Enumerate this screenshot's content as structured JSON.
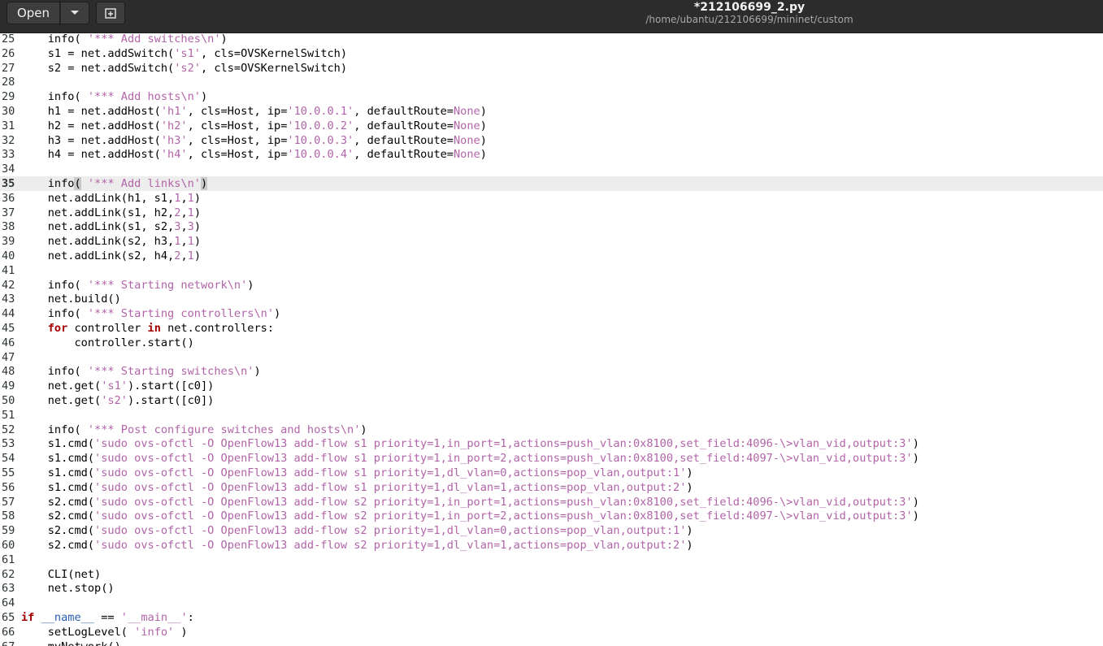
{
  "toolbar": {
    "open_label": "Open",
    "dropdown_icon": "chevron-down-icon",
    "new_tab_icon": "new-tab-icon"
  },
  "window": {
    "title": "*212106699_2.py",
    "subtitle": "/home/ubantu/212106699/mininet/custom"
  },
  "colors": {
    "string": "#b264a8",
    "keyword": "#a40000",
    "current_line": "#ededed",
    "headerbar": "#2c2c2c"
  },
  "editor": {
    "current_line": "35",
    "lines": [
      {
        "num": "25",
        "tokens": [
          [
            "",
            "    info( "
          ],
          [
            "s",
            "'*** Add switches\\n'"
          ],
          [
            "",
            ")"
          ]
        ]
      },
      {
        "num": "26",
        "tokens": [
          [
            "",
            "    s1 = net.addSwitch("
          ],
          [
            "s",
            "'s1'"
          ],
          [
            "",
            ", cls=OVSKernelSwitch)"
          ]
        ]
      },
      {
        "num": "27",
        "tokens": [
          [
            "",
            "    s2 = net.addSwitch("
          ],
          [
            "s",
            "'s2'"
          ],
          [
            "",
            ", cls=OVSKernelSwitch)"
          ]
        ]
      },
      {
        "num": "28",
        "tokens": []
      },
      {
        "num": "29",
        "tokens": [
          [
            "",
            "    info( "
          ],
          [
            "s",
            "'*** Add hosts\\n'"
          ],
          [
            "",
            ")"
          ]
        ]
      },
      {
        "num": "30",
        "tokens": [
          [
            "",
            "    h1 = net.addHost("
          ],
          [
            "s",
            "'h1'"
          ],
          [
            "",
            ", cls=Host, ip="
          ],
          [
            "s",
            "'10.0.0.1'"
          ],
          [
            "",
            ", defaultRoute="
          ],
          [
            "n",
            "None"
          ],
          [
            "",
            ")"
          ]
        ]
      },
      {
        "num": "31",
        "tokens": [
          [
            "",
            "    h2 = net.addHost("
          ],
          [
            "s",
            "'h2'"
          ],
          [
            "",
            ", cls=Host, ip="
          ],
          [
            "s",
            "'10.0.0.2'"
          ],
          [
            "",
            ", defaultRoute="
          ],
          [
            "n",
            "None"
          ],
          [
            "",
            ")"
          ]
        ]
      },
      {
        "num": "32",
        "tokens": [
          [
            "",
            "    h3 = net.addHost("
          ],
          [
            "s",
            "'h3'"
          ],
          [
            "",
            ", cls=Host, ip="
          ],
          [
            "s",
            "'10.0.0.3'"
          ],
          [
            "",
            ", defaultRoute="
          ],
          [
            "n",
            "None"
          ],
          [
            "",
            ")"
          ]
        ]
      },
      {
        "num": "33",
        "tokens": [
          [
            "",
            "    h4 = net.addHost("
          ],
          [
            "s",
            "'h4'"
          ],
          [
            "",
            ", cls=Host, ip="
          ],
          [
            "s",
            "'10.0.0.4'"
          ],
          [
            "",
            ", defaultRoute="
          ],
          [
            "n",
            "None"
          ],
          [
            "",
            ")"
          ]
        ]
      },
      {
        "num": "34",
        "tokens": []
      },
      {
        "num": "35",
        "tokens": [
          [
            "",
            "    info"
          ],
          [
            "bracket",
            "("
          ],
          [
            "",
            " "
          ],
          [
            "s",
            "'*** Add links\\n'"
          ],
          [
            "bracket",
            ")"
          ]
        ]
      },
      {
        "num": "36",
        "tokens": [
          [
            "",
            "    net.addLink(h1, s1,"
          ],
          [
            "s",
            "1"
          ],
          [
            "",
            ","
          ],
          [
            "s",
            "1"
          ],
          [
            "",
            ")"
          ]
        ]
      },
      {
        "num": "37",
        "tokens": [
          [
            "",
            "    net.addLink(s1, h2,"
          ],
          [
            "s",
            "2"
          ],
          [
            "",
            ","
          ],
          [
            "s",
            "1"
          ],
          [
            "",
            ")"
          ]
        ]
      },
      {
        "num": "38",
        "tokens": [
          [
            "",
            "    net.addLink(s1, s2,"
          ],
          [
            "s",
            "3"
          ],
          [
            "",
            ","
          ],
          [
            "s",
            "3"
          ],
          [
            "",
            ")"
          ]
        ]
      },
      {
        "num": "39",
        "tokens": [
          [
            "",
            "    net.addLink(s2, h3,"
          ],
          [
            "s",
            "1"
          ],
          [
            "",
            ","
          ],
          [
            "s",
            "1"
          ],
          [
            "",
            ")"
          ]
        ]
      },
      {
        "num": "40",
        "tokens": [
          [
            "",
            "    net.addLink(s2, h4,"
          ],
          [
            "s",
            "2"
          ],
          [
            "",
            ","
          ],
          [
            "s",
            "1"
          ],
          [
            "",
            ")"
          ]
        ]
      },
      {
        "num": "41",
        "tokens": []
      },
      {
        "num": "42",
        "tokens": [
          [
            "",
            "    info( "
          ],
          [
            "s",
            "'*** Starting network\\n'"
          ],
          [
            "",
            ")"
          ]
        ]
      },
      {
        "num": "43",
        "tokens": [
          [
            "",
            "    net.build()"
          ]
        ]
      },
      {
        "num": "44",
        "tokens": [
          [
            "",
            "    info( "
          ],
          [
            "s",
            "'*** Starting controllers\\n'"
          ],
          [
            "",
            ")"
          ]
        ]
      },
      {
        "num": "45",
        "tokens": [
          [
            "",
            "    "
          ],
          [
            "k",
            "for"
          ],
          [
            "",
            " controller "
          ],
          [
            "k",
            "in"
          ],
          [
            "",
            " net.controllers:"
          ]
        ]
      },
      {
        "num": "46",
        "tokens": [
          [
            "",
            "        controller.start()"
          ]
        ]
      },
      {
        "num": "47",
        "tokens": []
      },
      {
        "num": "48",
        "tokens": [
          [
            "",
            "    info( "
          ],
          [
            "s",
            "'*** Starting switches\\n'"
          ],
          [
            "",
            ")"
          ]
        ]
      },
      {
        "num": "49",
        "tokens": [
          [
            "",
            "    net.get("
          ],
          [
            "s",
            "'s1'"
          ],
          [
            "",
            ").start([c0])"
          ]
        ]
      },
      {
        "num": "50",
        "tokens": [
          [
            "",
            "    net.get("
          ],
          [
            "s",
            "'s2'"
          ],
          [
            "",
            ").start([c0])"
          ]
        ]
      },
      {
        "num": "51",
        "tokens": []
      },
      {
        "num": "52",
        "tokens": [
          [
            "",
            "    info( "
          ],
          [
            "s",
            "'*** Post configure switches and hosts\\n'"
          ],
          [
            "",
            ")"
          ]
        ]
      },
      {
        "num": "53",
        "tokens": [
          [
            "",
            "    s1.cmd("
          ],
          [
            "s",
            "'sudo ovs-ofctl -O OpenFlow13 add-flow s1 priority=1,in_port=1,actions=push_vlan:0x8100,set_field:4096-\\>vlan_vid,output:3'"
          ],
          [
            "",
            ")"
          ]
        ]
      },
      {
        "num": "54",
        "tokens": [
          [
            "",
            "    s1.cmd("
          ],
          [
            "s",
            "'sudo ovs-ofctl -O OpenFlow13 add-flow s1 priority=1,in_port=2,actions=push_vlan:0x8100,set_field:4097-\\>vlan_vid,output:3'"
          ],
          [
            "",
            ")"
          ]
        ]
      },
      {
        "num": "55",
        "tokens": [
          [
            "",
            "    s1.cmd("
          ],
          [
            "s",
            "'sudo ovs-ofctl -O OpenFlow13 add-flow s1 priority=1,dl_vlan=0,actions=pop_vlan,output:1'"
          ],
          [
            "",
            ")"
          ]
        ]
      },
      {
        "num": "56",
        "tokens": [
          [
            "",
            "    s1.cmd("
          ],
          [
            "s",
            "'sudo ovs-ofctl -O OpenFlow13 add-flow s1 priority=1,dl_vlan=1,actions=pop_vlan,output:2'"
          ],
          [
            "",
            ")"
          ]
        ]
      },
      {
        "num": "57",
        "tokens": [
          [
            "",
            "    s2.cmd("
          ],
          [
            "s",
            "'sudo ovs-ofctl -O OpenFlow13 add-flow s2 priority=1,in_port=1,actions=push_vlan:0x8100,set_field:4096-\\>vlan_vid,output:3'"
          ],
          [
            "",
            ")"
          ]
        ]
      },
      {
        "num": "58",
        "tokens": [
          [
            "",
            "    s2.cmd("
          ],
          [
            "s",
            "'sudo ovs-ofctl -O OpenFlow13 add-flow s2 priority=1,in_port=2,actions=push_vlan:0x8100,set_field:4097-\\>vlan_vid,output:3'"
          ],
          [
            "",
            ")"
          ]
        ]
      },
      {
        "num": "59",
        "tokens": [
          [
            "",
            "    s2.cmd("
          ],
          [
            "s",
            "'sudo ovs-ofctl -O OpenFlow13 add-flow s2 priority=1,dl_vlan=0,actions=pop_vlan,output:1'"
          ],
          [
            "",
            ")"
          ]
        ]
      },
      {
        "num": "60",
        "tokens": [
          [
            "",
            "    s2.cmd("
          ],
          [
            "s",
            "'sudo ovs-ofctl -O OpenFlow13 add-flow s2 priority=1,dl_vlan=1,actions=pop_vlan,output:2'"
          ],
          [
            "",
            ")"
          ]
        ]
      },
      {
        "num": "61",
        "tokens": []
      },
      {
        "num": "62",
        "tokens": [
          [
            "",
            "    CLI(net)"
          ]
        ]
      },
      {
        "num": "63",
        "tokens": [
          [
            "",
            "    net.stop()"
          ]
        ]
      },
      {
        "num": "64",
        "tokens": []
      },
      {
        "num": "65",
        "tokens": [
          [
            "k",
            "if"
          ],
          [
            "",
            " "
          ],
          [
            "b",
            "__name__"
          ],
          [
            "",
            " == "
          ],
          [
            "s",
            "'__main__'"
          ],
          [
            "",
            ":"
          ]
        ]
      },
      {
        "num": "66",
        "tokens": [
          [
            "",
            "    setLogLevel( "
          ],
          [
            "s",
            "'info'"
          ],
          [
            "",
            " )"
          ]
        ]
      },
      {
        "num": "67",
        "tokens": [
          [
            "",
            "    myNetwork()"
          ]
        ]
      }
    ]
  }
}
